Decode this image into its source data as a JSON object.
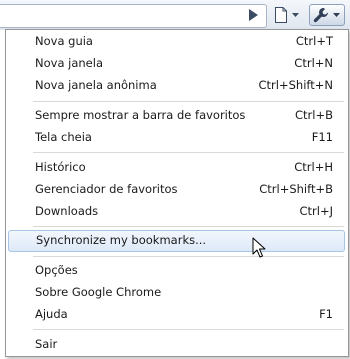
{
  "toolbar": {
    "icons": [
      "play-arrow-icon",
      "page-icon",
      "wrench-icon"
    ]
  },
  "menu": {
    "groups": [
      [
        {
          "label": "Nova guia",
          "shortcut": "Ctrl+T"
        },
        {
          "label": "Nova janela",
          "shortcut": "Ctrl+N"
        },
        {
          "label": "Nova janela anônima",
          "shortcut": "Ctrl+Shift+N"
        }
      ],
      [
        {
          "label": "Sempre mostrar a barra de favoritos",
          "shortcut": "Ctrl+B"
        },
        {
          "label": "Tela cheia",
          "shortcut": "F11"
        }
      ],
      [
        {
          "label": "Histórico",
          "shortcut": "Ctrl+H"
        },
        {
          "label": "Gerenciador de favoritos",
          "shortcut": "Ctrl+Shift+B"
        },
        {
          "label": "Downloads",
          "shortcut": "Ctrl+J"
        }
      ],
      [
        {
          "label": "Synchronize my bookmarks...",
          "shortcut": "",
          "highlighted": true
        }
      ],
      [
        {
          "label": "Opções",
          "shortcut": ""
        },
        {
          "label": "Sobre Google Chrome",
          "shortcut": ""
        },
        {
          "label": "Ajuda",
          "shortcut": "F1"
        }
      ],
      [
        {
          "label": "Sair",
          "shortcut": ""
        }
      ]
    ]
  },
  "colors": {
    "highlight_border": "#a8c4e6",
    "highlight_fill": "#dde9f8",
    "separator": "#d9d9d9"
  }
}
